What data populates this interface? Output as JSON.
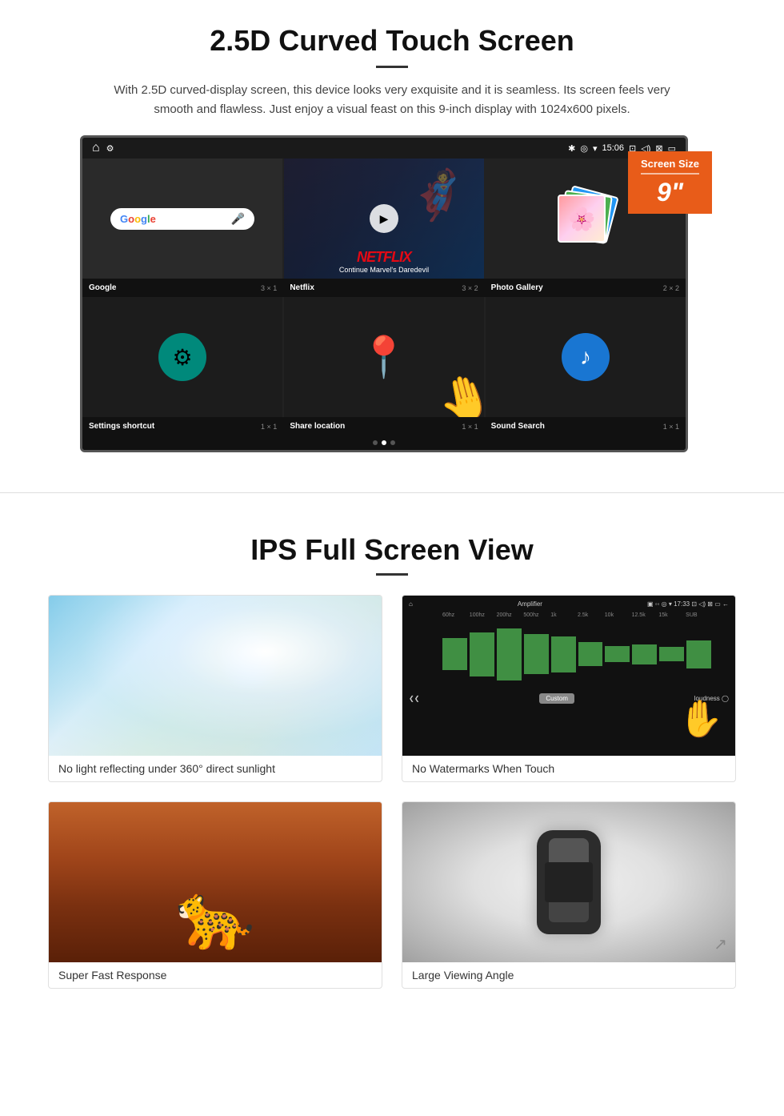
{
  "section1": {
    "title": "2.5D Curved Touch Screen",
    "description": "With 2.5D curved-display screen, this device looks very exquisite and it is seamless. Its screen feels very smooth and flawless. Just enjoy a visual feast on this 9-inch display with 1024x600 pixels.",
    "screen_badge": {
      "label": "Screen Size",
      "size": "9\""
    },
    "status_bar": {
      "time": "15:06"
    },
    "apps": [
      {
        "name": "Google",
        "size": "3 × 1"
      },
      {
        "name": "Netflix",
        "size": "3 × 2"
      },
      {
        "name": "Photo Gallery",
        "size": "2 × 2"
      },
      {
        "name": "Settings shortcut",
        "size": "1 × 1"
      },
      {
        "name": "Share location",
        "size": "1 × 1"
      },
      {
        "name": "Sound Search",
        "size": "1 × 1"
      }
    ],
    "netflix": {
      "logo": "NETFLIX",
      "subtitle": "Continue Marvel's Daredevil"
    }
  },
  "section2": {
    "title": "IPS Full Screen View",
    "features": [
      {
        "id": "sunlight",
        "caption": "No light reflecting under 360° direct sunlight"
      },
      {
        "id": "amplifier",
        "caption": "No Watermarks When Touch"
      },
      {
        "id": "cheetah",
        "caption": "Super Fast Response"
      },
      {
        "id": "car",
        "caption": "Large Viewing Angle"
      }
    ]
  }
}
